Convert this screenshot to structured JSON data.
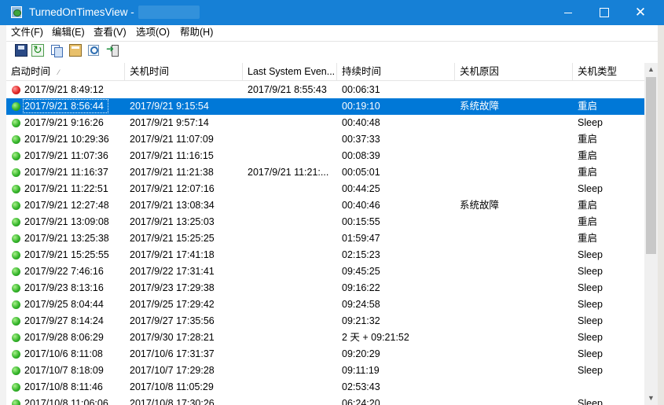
{
  "window": {
    "title": "TurnedOnTimesView  -",
    "minimize_label": "",
    "close_label": "✕"
  },
  "menu": [
    {
      "label": "文件(F)"
    },
    {
      "label": "编辑(E)"
    },
    {
      "label": "查看(V)"
    },
    {
      "label": "选项(O)"
    },
    {
      "label": "帮助(H)"
    }
  ],
  "toolbar": {
    "icons": [
      "save-icon",
      "refresh-icon",
      "copy-icon",
      "properties-icon",
      "find-icon",
      "exit-icon"
    ]
  },
  "columns": [
    {
      "label": "启动时间",
      "sort": "ascending"
    },
    {
      "label": "关机时间"
    },
    {
      "label": "Last System Even..."
    },
    {
      "label": "持续时间"
    },
    {
      "label": "关机原因"
    },
    {
      "label": "关机类型"
    }
  ],
  "rows": [
    {
      "status": "red",
      "start": "2017/9/21 8:49:12",
      "end": "",
      "last_event": "2017/9/21 8:55:43",
      "duration": "00:06:31",
      "reason": "",
      "type": ""
    },
    {
      "status": "green",
      "start": "2017/9/21 8:56:44",
      "end": "2017/9/21 9:15:54",
      "last_event": "",
      "duration": "00:19:10",
      "reason": "系统故障",
      "type": "重启",
      "selected": true
    },
    {
      "status": "green",
      "start": "2017/9/21 9:16:26",
      "end": "2017/9/21 9:57:14",
      "last_event": "",
      "duration": "00:40:48",
      "reason": "",
      "type": "Sleep"
    },
    {
      "status": "green",
      "start": "2017/9/21 10:29:36",
      "end": "2017/9/21 11:07:09",
      "last_event": "",
      "duration": "00:37:33",
      "reason": "",
      "type": "重启"
    },
    {
      "status": "green",
      "start": "2017/9/21 11:07:36",
      "end": "2017/9/21 11:16:15",
      "last_event": "",
      "duration": "00:08:39",
      "reason": "",
      "type": "重启"
    },
    {
      "status": "green",
      "start": "2017/9/21 11:16:37",
      "end": "2017/9/21 11:21:38",
      "last_event": "2017/9/21 11:21:...",
      "duration": "00:05:01",
      "reason": "",
      "type": "重启"
    },
    {
      "status": "green",
      "start": "2017/9/21 11:22:51",
      "end": "2017/9/21 12:07:16",
      "last_event": "",
      "duration": "00:44:25",
      "reason": "",
      "type": "Sleep"
    },
    {
      "status": "green",
      "start": "2017/9/21 12:27:48",
      "end": "2017/9/21 13:08:34",
      "last_event": "",
      "duration": "00:40:46",
      "reason": "系统故障",
      "type": "重启"
    },
    {
      "status": "green",
      "start": "2017/9/21 13:09:08",
      "end": "2017/9/21 13:25:03",
      "last_event": "",
      "duration": "00:15:55",
      "reason": "",
      "type": "重启"
    },
    {
      "status": "green",
      "start": "2017/9/21 13:25:38",
      "end": "2017/9/21 15:25:25",
      "last_event": "",
      "duration": "01:59:47",
      "reason": "",
      "type": "重启"
    },
    {
      "status": "green",
      "start": "2017/9/21 15:25:55",
      "end": "2017/9/21 17:41:18",
      "last_event": "",
      "duration": "02:15:23",
      "reason": "",
      "type": "Sleep"
    },
    {
      "status": "green",
      "start": "2017/9/22 7:46:16",
      "end": "2017/9/22 17:31:41",
      "last_event": "",
      "duration": "09:45:25",
      "reason": "",
      "type": "Sleep"
    },
    {
      "status": "green",
      "start": "2017/9/23 8:13:16",
      "end": "2017/9/23 17:29:38",
      "last_event": "",
      "duration": "09:16:22",
      "reason": "",
      "type": "Sleep"
    },
    {
      "status": "green",
      "start": "2017/9/25 8:04:44",
      "end": "2017/9/25 17:29:42",
      "last_event": "",
      "duration": "09:24:58",
      "reason": "",
      "type": "Sleep"
    },
    {
      "status": "green",
      "start": "2017/9/27 8:14:24",
      "end": "2017/9/27 17:35:56",
      "last_event": "",
      "duration": "09:21:32",
      "reason": "",
      "type": "Sleep"
    },
    {
      "status": "green",
      "start": "2017/9/28 8:06:29",
      "end": "2017/9/30 17:28:21",
      "last_event": "",
      "duration": "2 天 + 09:21:52",
      "reason": "",
      "type": "Sleep"
    },
    {
      "status": "green",
      "start": "2017/10/6 8:11:08",
      "end": "2017/10/6 17:31:37",
      "last_event": "",
      "duration": "09:20:29",
      "reason": "",
      "type": "Sleep"
    },
    {
      "status": "green",
      "start": "2017/10/7 8:18:09",
      "end": "2017/10/7 17:29:28",
      "last_event": "",
      "duration": "09:11:19",
      "reason": "",
      "type": "Sleep"
    },
    {
      "status": "green",
      "start": "2017/10/8 8:11:46",
      "end": "2017/10/8 11:05:29",
      "last_event": "",
      "duration": "02:53:43",
      "reason": "",
      "type": ""
    },
    {
      "status": "green",
      "start": "2017/10/8 11:06:06",
      "end": "2017/10/8 17:30:26",
      "last_event": "",
      "duration": "06:24:20",
      "reason": "",
      "type": "Sleep"
    }
  ],
  "colors": {
    "titlebar": "#1680d6",
    "selection": "#0078d7",
    "status_green": "#34b52a",
    "status_red": "#e22727"
  }
}
